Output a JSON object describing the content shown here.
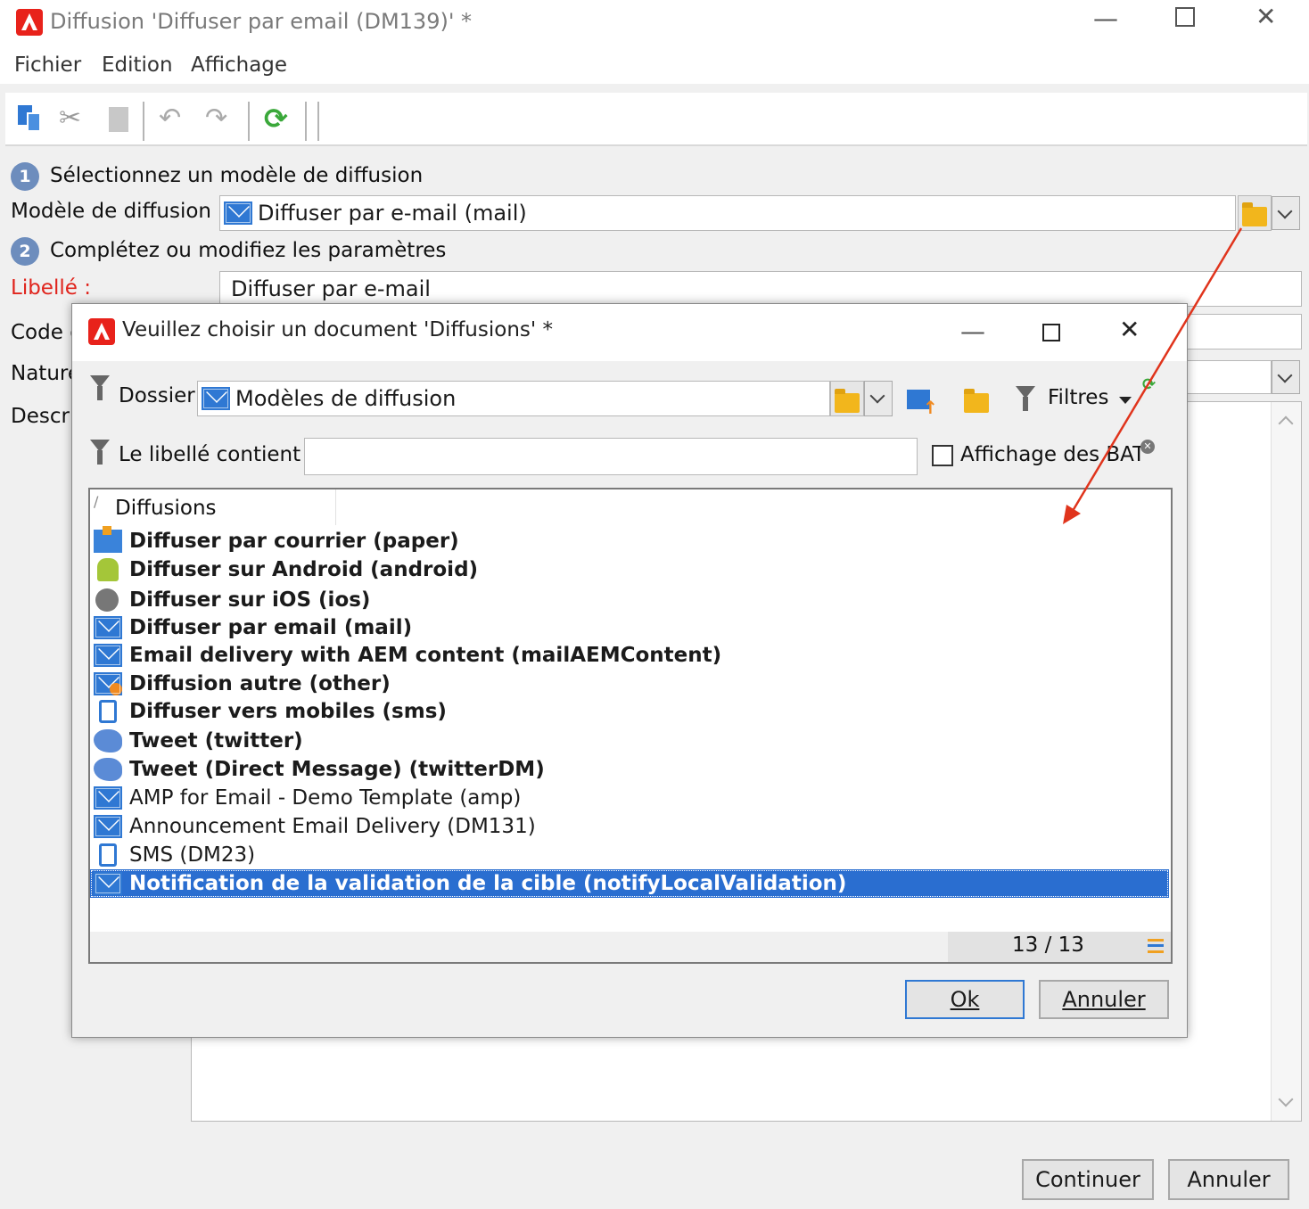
{
  "main_window": {
    "title": "Diffusion 'Diffuser par email (DM139)' *",
    "menu": [
      "Fichier",
      "Edition",
      "Affichage"
    ],
    "step1_label": "Sélectionnez un modèle de diffusion",
    "step2_label": "Complétez ou modifiez les paramètres",
    "step1_number": "1",
    "step2_number": "2",
    "modele_label": "Modèle de diffusion :",
    "modele_value": "Diffuser par e-mail (mail)",
    "libelle_label": "Libellé :",
    "libelle_value": "Diffuser par e-mail",
    "code_label": "Code d",
    "nature_label": "Nature",
    "description_label": "Descrip",
    "continue_button": "Continuer",
    "cancel_button": "Annuler"
  },
  "dialog": {
    "title": "Veuillez choisir un document 'Diffusions' *",
    "dossier_label": "Dossier :",
    "dossier_value": "Modèles de diffusion",
    "filters_label": "Filtres",
    "libelle_contient_label": "Le libellé contient :",
    "libelle_contient_value": "",
    "affichage_bat_label": "Affichage des BAT",
    "tree_header": "Diffusions",
    "items": [
      {
        "label": "Diffuser par courrier (paper)",
        "icon": "paper-mail-icon",
        "bold": true
      },
      {
        "label": "Diffuser sur Android (android)",
        "icon": "android-icon",
        "bold": true
      },
      {
        "label": "Diffuser sur iOS (ios)",
        "icon": "apple-icon",
        "bold": true
      },
      {
        "label": "Diffuser par email (mail)",
        "icon": "envelope-icon",
        "bold": true
      },
      {
        "label": "Email delivery with AEM content (mailAEMContent)",
        "icon": "envelope-icon",
        "bold": true
      },
      {
        "label": "Diffusion autre (other)",
        "icon": "envelope-other-icon",
        "bold": true
      },
      {
        "label": "Diffuser vers mobiles (sms)",
        "icon": "mobile-phone-icon",
        "bold": true
      },
      {
        "label": "Tweet (twitter)",
        "icon": "twitter-icon",
        "bold": true
      },
      {
        "label": "Tweet (Direct Message) (twitterDM)",
        "icon": "twitter-icon",
        "bold": true
      },
      {
        "label": "AMP for Email - Demo Template (amp)",
        "icon": "envelope-icon",
        "bold": false
      },
      {
        "label": "Announcement Email Delivery (DM131)",
        "icon": "envelope-icon",
        "bold": false
      },
      {
        "label": "SMS (DM23)",
        "icon": "mobile-phone-icon",
        "bold": false
      },
      {
        "label": "Notification de la validation de la cible (notifyLocalValidation)",
        "icon": "envelope-icon",
        "bold": true,
        "selected": true
      }
    ],
    "count": "13 / 13",
    "ok_button": "Ok",
    "cancel_button": "Annuler"
  },
  "colors": {
    "selection": "#2a6ed0",
    "label_required": "#e0241c",
    "annotation_arrow": "#e0341c"
  }
}
